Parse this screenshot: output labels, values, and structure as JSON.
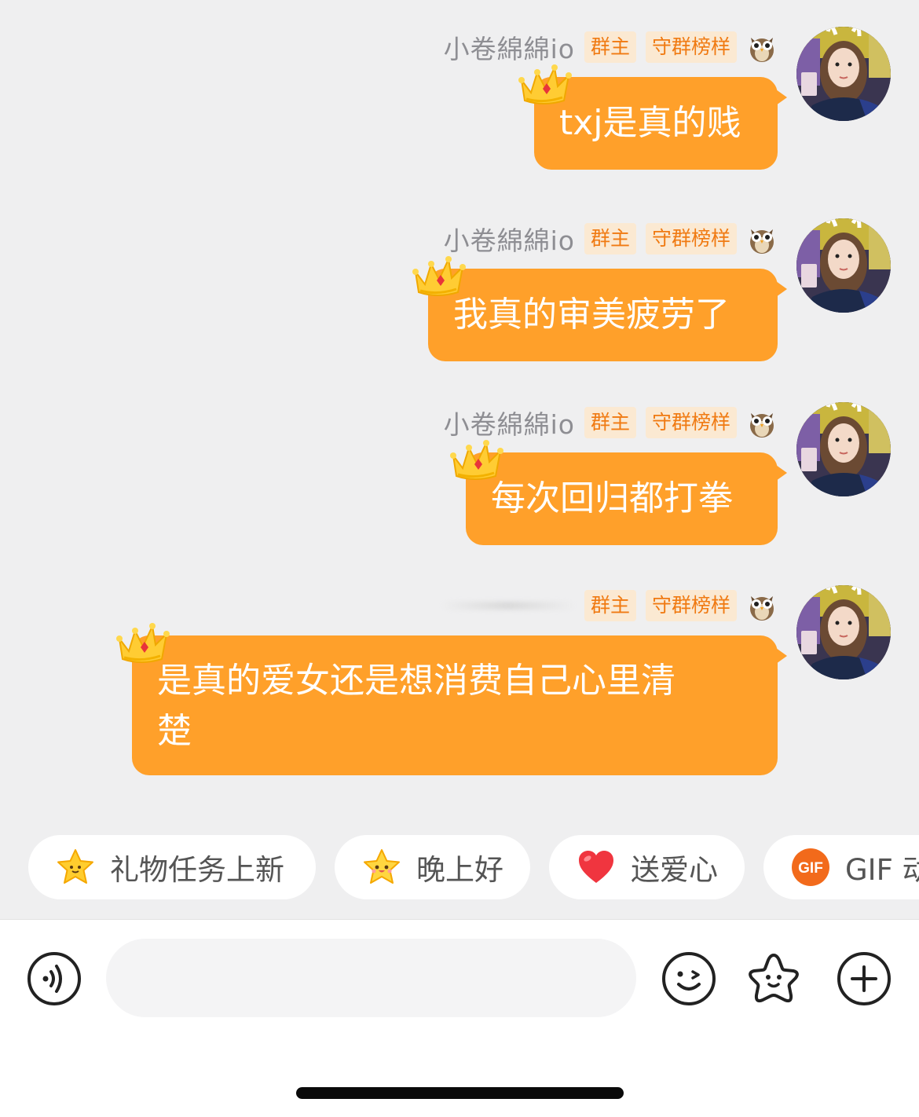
{
  "messages": [
    {
      "username": "小卷綿綿io",
      "badges": [
        "群主",
        "守群榜样"
      ],
      "text": "txj是真的贱"
    },
    {
      "username": "小卷綿綿io",
      "badges": [
        "群主",
        "守群榜样"
      ],
      "text": "我真的审美疲劳了"
    },
    {
      "username": "小卷綿綿io",
      "badges": [
        "群主",
        "守群榜样"
      ],
      "text": "每次回归都打拳"
    },
    {
      "username": "",
      "badges": [
        "群主",
        "守群榜样"
      ],
      "text_line1": "是真的爱女还是想消费自己心里清",
      "text_line2": "楚"
    }
  ],
  "quick_replies": [
    {
      "label": "礼物任务上新",
      "icon": "star-icon"
    },
    {
      "label": "晚上好",
      "icon": "smiling-star-icon"
    },
    {
      "label": "送爱心",
      "icon": "heart-icon"
    },
    {
      "label": "GIF 动",
      "icon": "gif-icon",
      "icon_text": "GIF"
    }
  ],
  "input_bar": {
    "placeholder": "",
    "icons": [
      "voice-icon",
      "emoji-icon",
      "sticker-star-icon",
      "plus-icon"
    ]
  },
  "colors": {
    "bubble": "#ffa02a",
    "badge_text": "#f07a12",
    "badge_bg": "#fbe9d2",
    "background": "#efeff0"
  }
}
